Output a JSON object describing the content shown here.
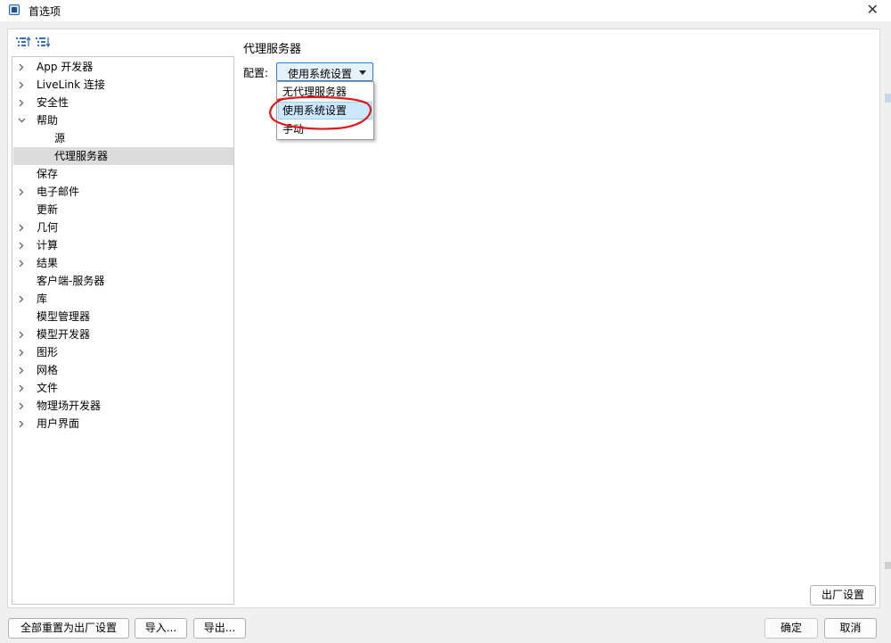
{
  "window": {
    "title": "首选项",
    "close_glyph": "✕"
  },
  "toolbar": {
    "expand_icon": "expand-all-icon",
    "collapse_icon": "collapse-all-icon"
  },
  "tree": {
    "items": [
      {
        "label": "App 开发器",
        "expandable": true,
        "expanded": false,
        "level": 0
      },
      {
        "label": "LiveLink 连接",
        "expandable": true,
        "expanded": false,
        "level": 0
      },
      {
        "label": "安全性",
        "expandable": true,
        "expanded": false,
        "level": 0
      },
      {
        "label": "帮助",
        "expandable": true,
        "expanded": true,
        "level": 0
      },
      {
        "label": "源",
        "expandable": false,
        "level": 1
      },
      {
        "label": "代理服务器",
        "expandable": false,
        "level": 1,
        "selected": true
      },
      {
        "label": "保存",
        "expandable": false,
        "level": 0
      },
      {
        "label": "电子邮件",
        "expandable": true,
        "expanded": false,
        "level": 0
      },
      {
        "label": "更新",
        "expandable": false,
        "level": 0
      },
      {
        "label": "几何",
        "expandable": true,
        "expanded": false,
        "level": 0
      },
      {
        "label": "计算",
        "expandable": true,
        "expanded": false,
        "level": 0
      },
      {
        "label": "结果",
        "expandable": true,
        "expanded": false,
        "level": 0
      },
      {
        "label": "客户端-服务器",
        "expandable": false,
        "level": 0
      },
      {
        "label": "库",
        "expandable": true,
        "expanded": false,
        "level": 0
      },
      {
        "label": "模型管理器",
        "expandable": false,
        "level": 0
      },
      {
        "label": "模型开发器",
        "expandable": true,
        "expanded": false,
        "level": 0
      },
      {
        "label": "图形",
        "expandable": true,
        "expanded": false,
        "level": 0
      },
      {
        "label": "网格",
        "expandable": true,
        "expanded": false,
        "level": 0
      },
      {
        "label": "文件",
        "expandable": true,
        "expanded": false,
        "level": 0
      },
      {
        "label": "物理场开发器",
        "expandable": true,
        "expanded": false,
        "level": 0
      },
      {
        "label": "用户界面",
        "expandable": true,
        "expanded": false,
        "level": 0
      }
    ]
  },
  "panel": {
    "title": "代理服务器",
    "config_label": "配置:",
    "config_value": "使用系统设置",
    "options": [
      "无代理服务器",
      "使用系统设置",
      "手动"
    ],
    "highlighted_option": 1,
    "annotation_color": "#e0191e",
    "factory_reset_label": "出厂设置"
  },
  "footer": {
    "reset_all_label": "全部重置为出厂设置",
    "import_label": "导入...",
    "export_label": "导出...",
    "ok_label": "确定",
    "cancel_label": "取消"
  }
}
